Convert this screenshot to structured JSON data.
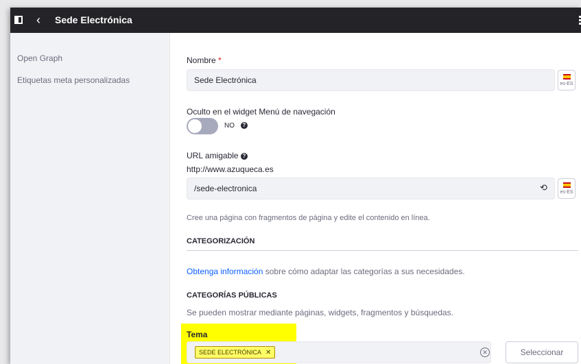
{
  "header": {
    "title": "Sede Electrónica"
  },
  "sidebar": {
    "items": [
      {
        "label": "Open Graph"
      },
      {
        "label": "Etiquetas meta personalizadas"
      }
    ]
  },
  "form": {
    "nombre": {
      "label": "Nombre",
      "required_mark": "*",
      "value": "Sede Electrónica",
      "locale": "es-ES"
    },
    "hidden": {
      "label": "Oculto en el widget Menú de navegación",
      "state_label": "NO"
    },
    "url": {
      "label": "URL amigable",
      "base_url": "http://www.azuqueca.es",
      "value": "/sede-electronica",
      "locale": "es-ES"
    },
    "fragment_hint": "Cree una página con fragmentos de página y edite el contenido en línea."
  },
  "categorization": {
    "title": "CATEGORIZACIÓN",
    "info_link": "Obtenga información",
    "info_rest": " sobre cómo adaptar las categorías a sus necesidades.",
    "public_title": "CATEGORÍAS PÚBLICAS",
    "public_desc": "Se pueden mostrar mediante páginas, widgets, fragmentos y búsquedas.",
    "tema": {
      "label": "Tema",
      "tag": "SEDE ELECTRÓNICA",
      "select_label": "Seleccionar"
    }
  },
  "colors": {
    "highlight": "#ffff00",
    "topbar": "#242428",
    "link": "#0b5fff"
  }
}
